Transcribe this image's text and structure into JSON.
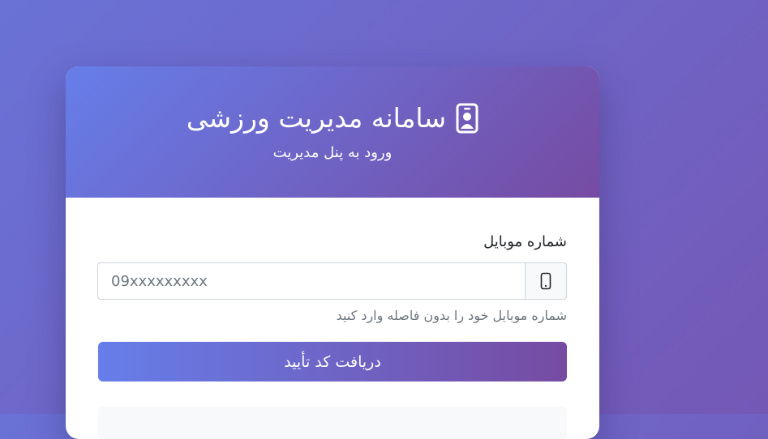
{
  "header": {
    "title": "سامانه مدیریت ورزشی",
    "title_icon": "person-badge-icon",
    "subtitle": "ورود به پنل مدیریت"
  },
  "form": {
    "mobile_label": "شماره موبایل",
    "mobile_placeholder": "09xxxxxxxxx",
    "mobile_value": "",
    "mobile_icon": "phone-icon",
    "help_text": "شماره موبایل خود را بدون فاصله وارد کنید",
    "submit_label": "دریافت کد تأیید"
  },
  "colors": {
    "gradient_start": "#667eea",
    "gradient_end": "#764ba2"
  }
}
